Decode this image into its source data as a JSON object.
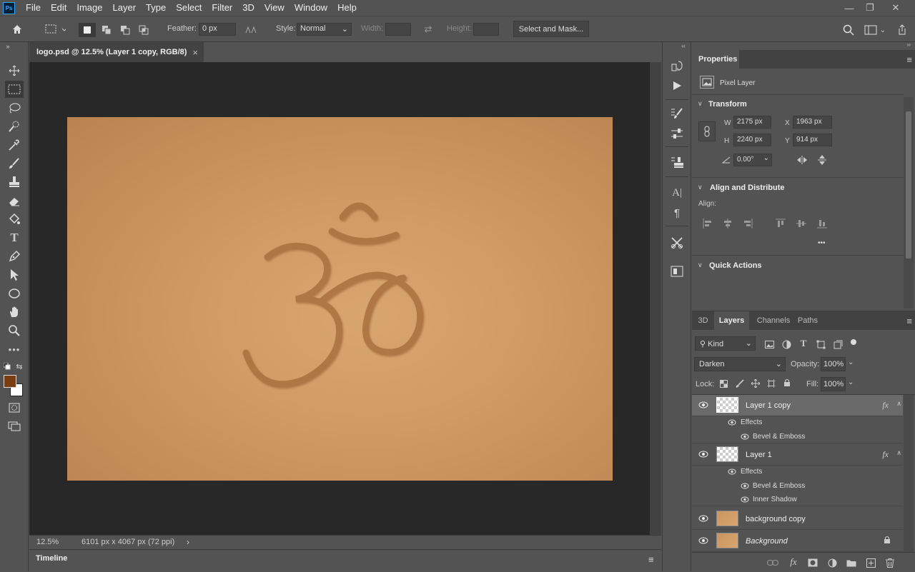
{
  "menubar": {
    "logo": "Ps",
    "items": [
      "File",
      "Edit",
      "Image",
      "Layer",
      "Type",
      "Select",
      "Filter",
      "3D",
      "View",
      "Window",
      "Help"
    ],
    "controls": [
      "—",
      "❐",
      "✕"
    ]
  },
  "options": {
    "feather_label": "Feather:",
    "feather_value": "0 px",
    "style_label": "Style:",
    "style_value": "Normal",
    "width_label": "Width:",
    "height_label": "Height:",
    "select_mask_label": "Select and Mask..."
  },
  "document": {
    "tab_title": "logo.psd @ 12.5% (Layer 1 copy, RGB/8)",
    "close_icon": "×",
    "zoom": "12.5%",
    "doc_info": "6101 px x 4067 px (72 ppi)",
    "foreground_color": "#7a3e12",
    "background_color": "#ffffff"
  },
  "timeline": {
    "label": "Timeline"
  },
  "properties": {
    "tab": "Properties",
    "layer_type": "Pixel Layer",
    "transform_title": "Transform",
    "w_label": "W",
    "w_value": "2175 px",
    "h_label": "H",
    "h_value": "2240 px",
    "x_label": "X",
    "x_value": "1963 px",
    "y_label": "Y",
    "y_value": "914 px",
    "angle_value": "0.00°",
    "align_title": "Align and Distribute",
    "align_label": "Align:",
    "more": "•••",
    "quick_actions_title": "Quick Actions"
  },
  "layers_panel": {
    "tabs": [
      "3D",
      "Layers",
      "Channels",
      "Paths"
    ],
    "filter_kind": "Kind",
    "blend_mode": "Darken",
    "opacity_label": "Opacity:",
    "opacity_value": "100%",
    "lock_label": "Lock:",
    "fill_label": "Fill:",
    "fill_value": "100%",
    "layers": [
      {
        "name": "Layer 1 copy",
        "fx": "fx",
        "effects_label": "Effects",
        "effects": [
          "Bevel & Emboss"
        ]
      },
      {
        "name": "Layer 1",
        "fx": "fx",
        "effects_label": "Effects",
        "effects": [
          "Bevel & Emboss",
          "Inner Shadow"
        ]
      },
      {
        "name": "background copy"
      },
      {
        "name": "Background"
      }
    ]
  }
}
